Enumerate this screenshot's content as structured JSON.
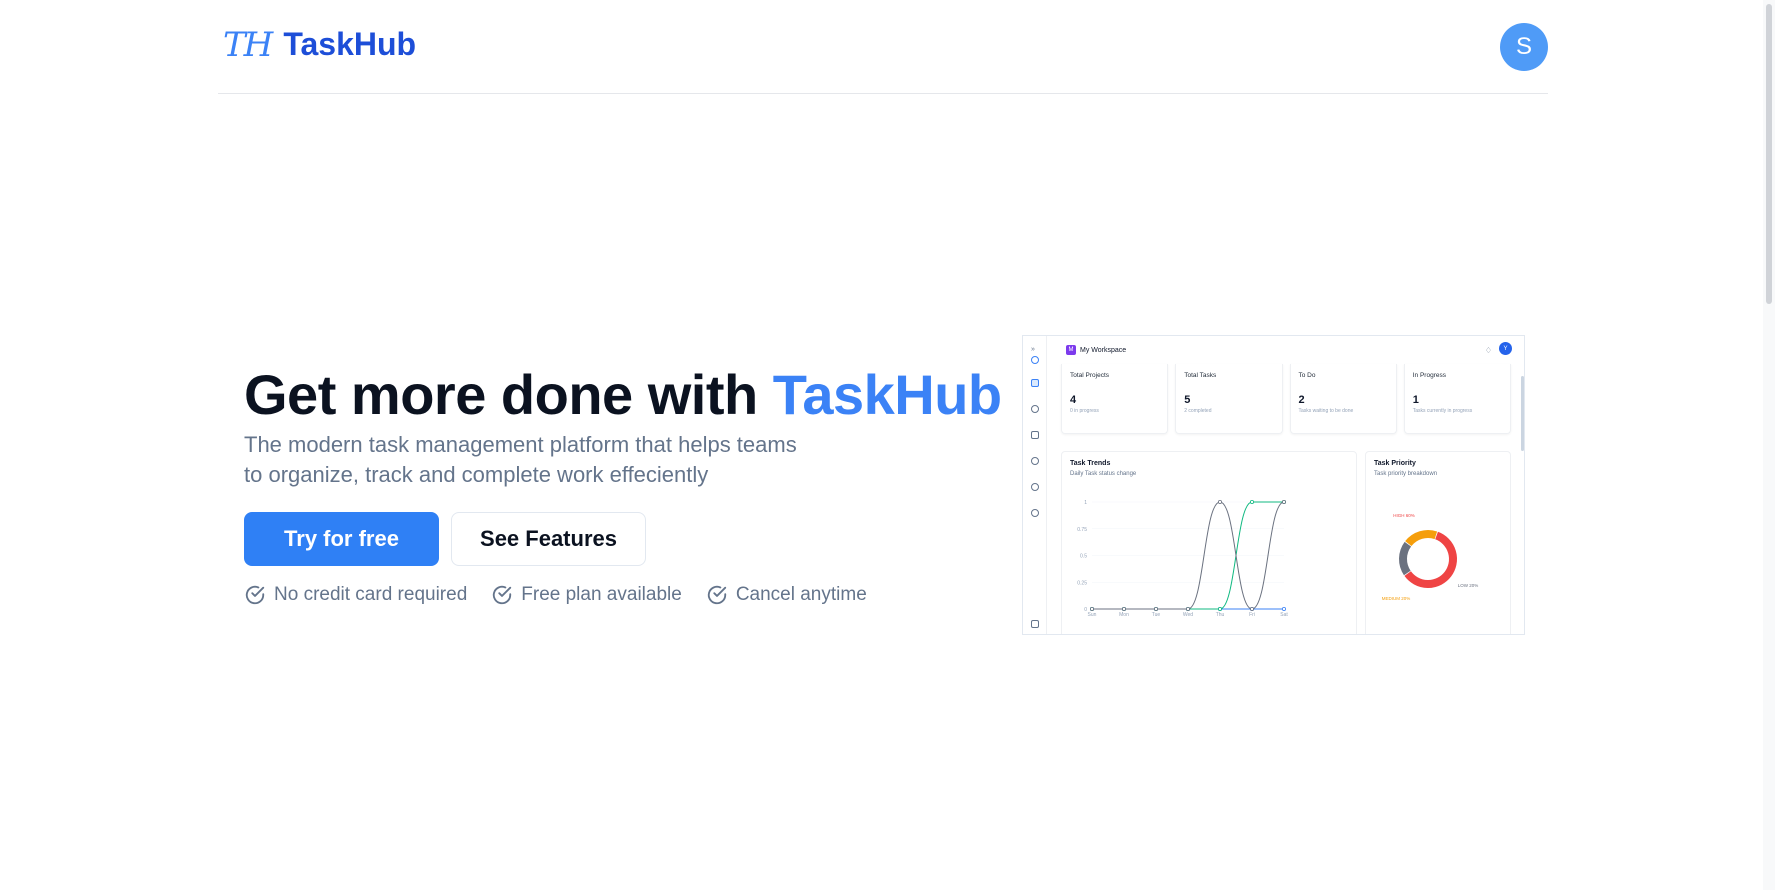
{
  "header": {
    "logo_mark": "TH",
    "app_name": "TaskHub",
    "avatar_initial": "S"
  },
  "hero": {
    "title_prefix": "Get more done with ",
    "title_accent": "TaskHub",
    "subtitle_line1": "The modern task management platform that helps teams",
    "subtitle_line2": "to organize, track and complete work effeciently",
    "primary_cta": "Try for free",
    "secondary_cta": "See Features",
    "perks": [
      "No credit card required",
      "Free plan available",
      "Cancel anytime"
    ]
  },
  "preview": {
    "workspace_initial": "M",
    "workspace_name": "My Workspace",
    "avatar_initial": "Y",
    "cards": [
      {
        "title": "Total Projects",
        "value": "4",
        "sub": "0 in progress"
      },
      {
        "title": "Total Tasks",
        "value": "5",
        "sub": "2 completed"
      },
      {
        "title": "To Do",
        "value": "2",
        "sub": "Tasks waiting to be done"
      },
      {
        "title": "In Progress",
        "value": "1",
        "sub": "Tasks currently in progress"
      }
    ],
    "trends_title": "Task Trends",
    "trends_sub": "Daily Task status change",
    "priority_title": "Task Priority",
    "priority_sub": "Task priority breakdown"
  },
  "chart_data": [
    {
      "type": "line",
      "title": "Task Trends",
      "x": [
        "Sun",
        "Mon",
        "Tue",
        "Wed",
        "Thu",
        "Fri",
        "Sat"
      ],
      "ylim": [
        0,
        1
      ],
      "yticks": [
        "0",
        "0.25",
        "0.5",
        "0.75",
        "1"
      ],
      "series": [
        {
          "color": "#6b7280",
          "values": [
            0,
            0,
            0,
            0,
            1,
            0,
            1
          ]
        },
        {
          "color": "#10b981",
          "values": [
            0,
            0,
            0,
            0,
            0,
            1,
            1
          ]
        },
        {
          "color": "#3b82f6",
          "values": [
            0,
            0,
            0,
            0,
            0,
            0,
            0
          ]
        }
      ]
    },
    {
      "type": "pie",
      "title": "Task Priority",
      "labels": [
        "HIGH 60%",
        "LOW 20%",
        "MEDIUM 20%"
      ],
      "values": [
        60,
        20,
        20
      ],
      "colors": [
        "#ef4444",
        "#6b7280",
        "#f59e0b"
      ]
    }
  ],
  "colors": {
    "brand": "#1d4ed8",
    "accent": "#3b82f6",
    "primary_button": "#2f80f5",
    "muted_text": "#64748b"
  }
}
